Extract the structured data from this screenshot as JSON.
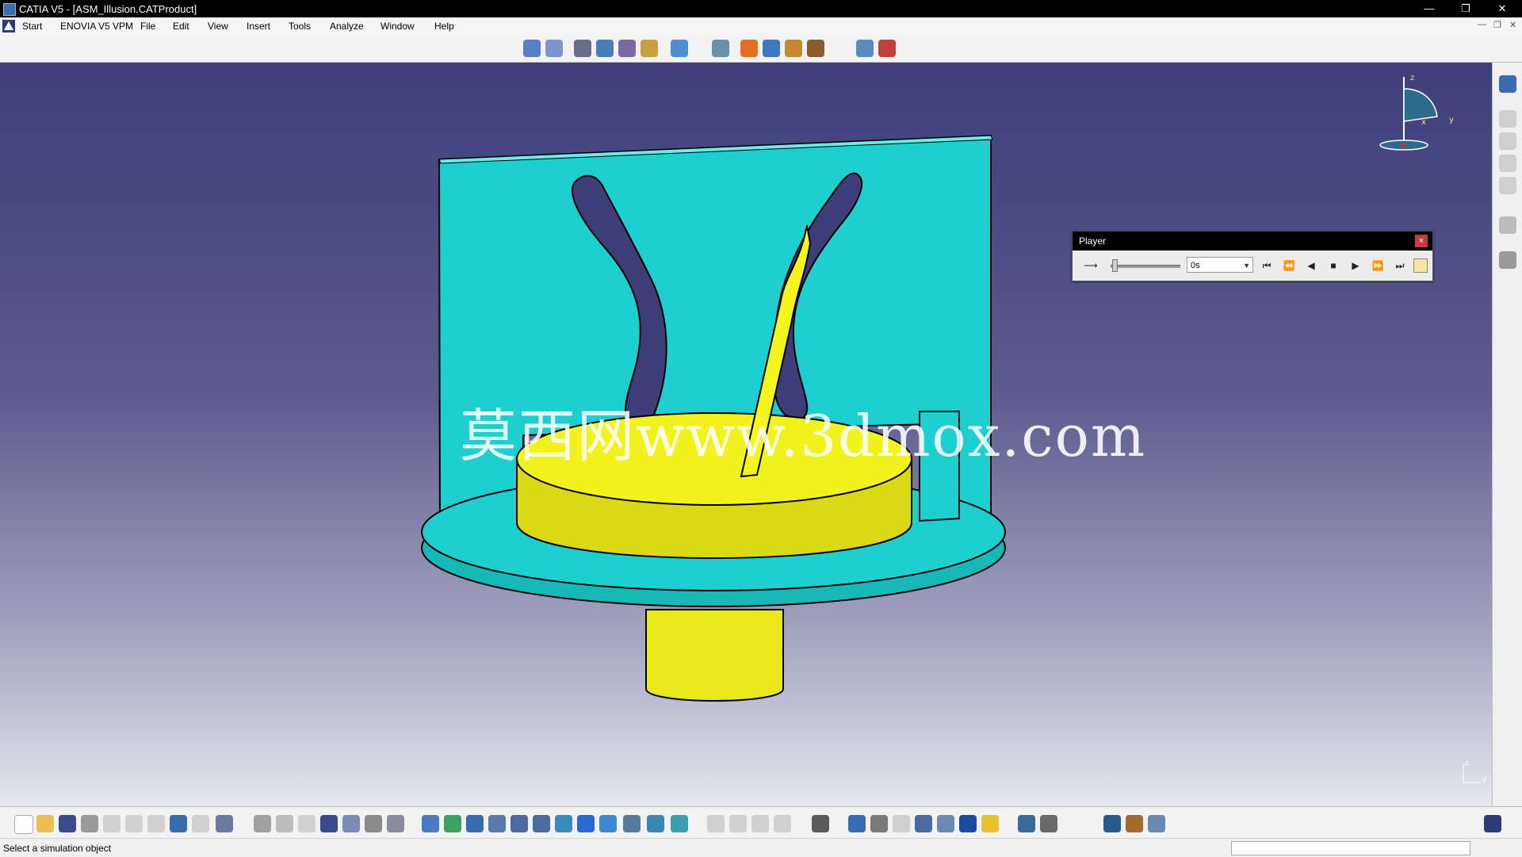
{
  "window": {
    "title": "CATIA V5 - [ASM_Illusion.CATProduct]",
    "controls": {
      "minimize": "—",
      "restore": "❐",
      "close": "✕"
    }
  },
  "menubar": {
    "items": [
      "Start",
      "ENOVIA V5 VPM",
      "File",
      "Edit",
      "View",
      "Insert",
      "Tools",
      "Analyze",
      "Window",
      "Help"
    ]
  },
  "watermark": "莫西网www.3dmox.com",
  "player": {
    "title": "Player",
    "close": "×",
    "time": "0s",
    "buttons": {
      "arrow": "⟶",
      "jump_start": "⏮",
      "step_back": "⏪",
      "play_back": "◀",
      "stop": "■",
      "play": "▶",
      "step_forward": "⏩",
      "jump_end": "⏭"
    }
  },
  "compass": {
    "z": "z",
    "x": "x",
    "y": "y"
  },
  "axis_mini": {
    "z": "z",
    "y": "y"
  },
  "status": {
    "message": "Select a simulation object"
  },
  "colors": {
    "cyan_part": "#1ecfcf",
    "yellow_part": "#e8e81a",
    "background_top": "#3e3e7a",
    "background_bottom": "#e7e7f0"
  },
  "icons": {
    "top": [
      "simulation-icon",
      "edit-simulation-icon",
      "compile-icon",
      "mechanism-icon",
      "speed-icon",
      "sensor-icon",
      "swept-volume-icon",
      "catalog-icon",
      "track-icon",
      "sequence-icon",
      "clash-icon",
      "measure-icon",
      "distance-icon",
      "replay-icon"
    ],
    "bottom": [
      "new-icon",
      "open-icon",
      "save-icon",
      "print-icon",
      "cut-icon",
      "copy-icon",
      "paste-icon",
      "undo-icon",
      "redo-icon",
      "help-icon",
      "formula-icon",
      "comment-icon",
      "pointer-icon",
      "grid-icon",
      "tree-icon",
      "assembly-icon",
      "constraint-icon",
      "fly-icon",
      "fit-all-icon",
      "pan-icon",
      "rotate-icon",
      "zoom-in-icon",
      "zoom-out-icon",
      "normal-view-icon",
      "multi-view-icon",
      "iso-view-icon",
      "shading-icon",
      "hide-show-icon",
      "swap-icon",
      "capture-icon",
      "compass-icon",
      "prev-icon",
      "next-icon",
      "search-icon",
      "filter-icon",
      "color-icon",
      "light-icon",
      "layer-icon",
      "dimension-icon",
      "update-icon",
      "sync-icon",
      "settings-icon"
    ]
  }
}
